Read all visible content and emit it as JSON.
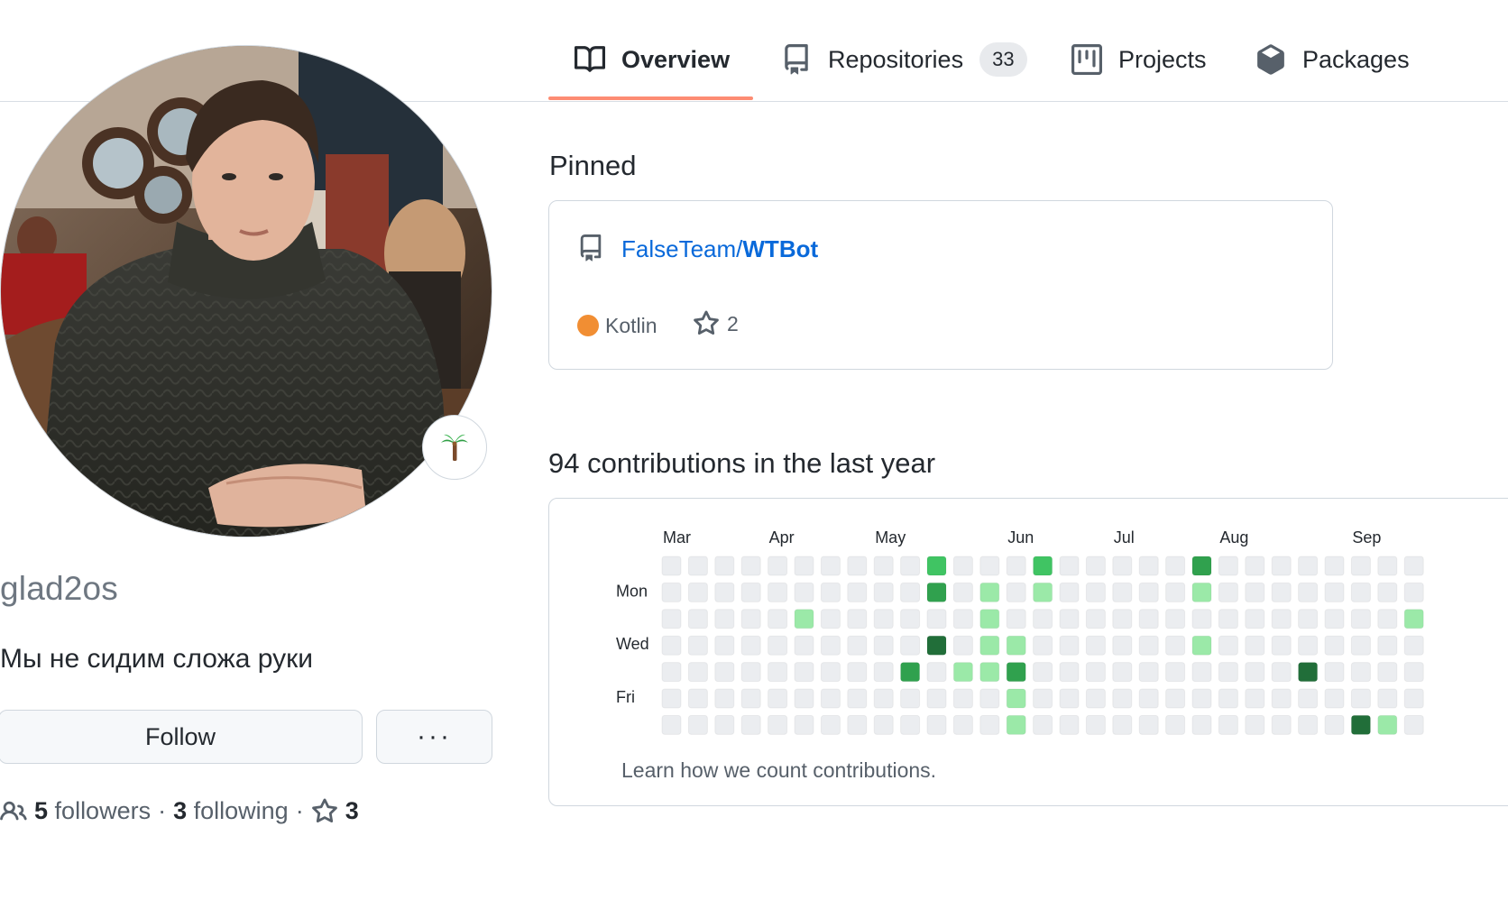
{
  "tabs": [
    {
      "label": "Overview",
      "icon": "book-icon",
      "active": true
    },
    {
      "label": "Repositories",
      "icon": "repo-icon",
      "count": "33"
    },
    {
      "label": "Projects",
      "icon": "project-icon"
    },
    {
      "label": "Packages",
      "icon": "package-icon"
    }
  ],
  "profile": {
    "avatar": "profile-photo",
    "status_emoji": "palm-tree-icon",
    "username": "glad2os",
    "bio": "Мы не сидим сложа руки",
    "follow_label": "Follow",
    "more_label": "···",
    "followers_count": "5",
    "followers_label": "followers",
    "following_count": "3",
    "following_label": "following",
    "stars_count": "3",
    "separator": "·"
  },
  "pinned": {
    "title": "Pinned",
    "items": [
      {
        "owner": "FalseTeam/",
        "name": "WTBot",
        "language": "Kotlin",
        "language_color": "#F18E33",
        "stars": "2"
      }
    ]
  },
  "contributions": {
    "title": "94 contributions in the last year",
    "months": [
      "Mar",
      "Apr",
      "May",
      "Jun",
      "Jul",
      "Aug",
      "Sep"
    ],
    "month_start_weeks": [
      0,
      4,
      8,
      13,
      17,
      21,
      26
    ],
    "day_labels": [
      "",
      "Mon",
      "",
      "Wed",
      "",
      "Fri",
      ""
    ],
    "levels": [
      [
        0,
        0,
        0,
        0,
        0,
        0,
        0,
        0,
        0,
        0,
        2,
        0,
        0,
        0,
        2,
        0,
        0,
        0,
        0,
        0,
        3,
        0,
        0,
        0,
        0,
        0,
        0,
        0,
        0
      ],
      [
        0,
        0,
        0,
        0,
        0,
        0,
        0,
        0,
        0,
        0,
        3,
        0,
        1,
        0,
        1,
        0,
        0,
        0,
        0,
        0,
        1,
        0,
        0,
        0,
        0,
        0,
        0,
        0,
        0
      ],
      [
        0,
        0,
        0,
        0,
        0,
        1,
        0,
        0,
        0,
        0,
        0,
        0,
        1,
        0,
        0,
        0,
        0,
        0,
        0,
        0,
        0,
        0,
        0,
        0,
        0,
        0,
        0,
        0,
        1
      ],
      [
        0,
        0,
        0,
        0,
        0,
        0,
        0,
        0,
        0,
        0,
        4,
        0,
        1,
        1,
        0,
        0,
        0,
        0,
        0,
        0,
        1,
        0,
        0,
        0,
        0,
        0,
        0,
        0,
        0
      ],
      [
        0,
        0,
        0,
        0,
        0,
        0,
        0,
        0,
        0,
        3,
        0,
        1,
        1,
        3,
        0,
        0,
        0,
        0,
        0,
        0,
        0,
        0,
        0,
        0,
        4,
        0,
        0,
        0,
        0
      ],
      [
        0,
        0,
        0,
        0,
        0,
        0,
        0,
        0,
        0,
        0,
        0,
        0,
        0,
        1,
        0,
        0,
        0,
        0,
        0,
        0,
        0,
        0,
        0,
        0,
        0,
        0,
        0,
        0,
        0
      ],
      [
        0,
        0,
        0,
        0,
        0,
        0,
        0,
        0,
        0,
        0,
        0,
        0,
        0,
        1,
        0,
        0,
        0,
        0,
        0,
        0,
        0,
        0,
        0,
        0,
        0,
        0,
        4,
        1,
        0
      ]
    ],
    "level_colors": [
      "#ebedf0",
      "#9be9a8",
      "#40c463",
      "#30a14e",
      "#216e39"
    ],
    "learn_label": "Learn how we count contributions."
  }
}
